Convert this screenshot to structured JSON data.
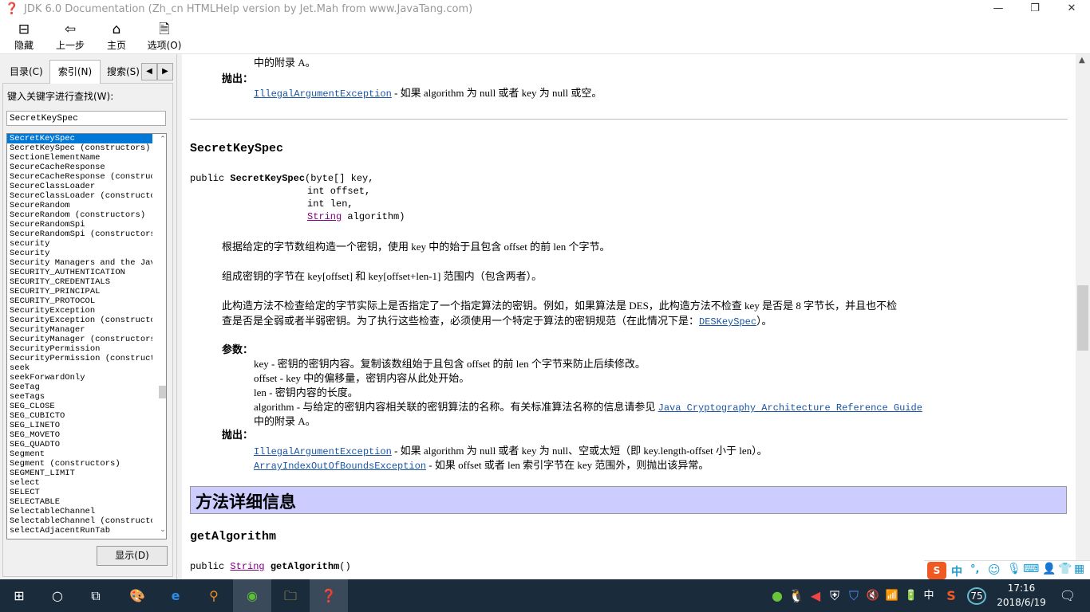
{
  "window": {
    "title": "JDK 6.0 Documentation (Zh_cn HTMLHelp version by Jet.Mah from www.JavaTang.com)"
  },
  "toolbar": {
    "hide": "隐藏",
    "back": "上一步",
    "home": "主页",
    "options": "选项(O)"
  },
  "tabs": {
    "contents": "目录(C)",
    "index": "索引(N)",
    "search": "搜索(S)"
  },
  "index": {
    "label": "键入关键字进行查找(W):",
    "value": "SecretKeySpec",
    "items": [
      "SecretKeySpec",
      "SecretKeySpec (constructors)",
      "SectionElementName",
      "SecureCacheResponse",
      "SecureCacheResponse (constructors)",
      "SecureClassLoader",
      "SecureClassLoader (constructors)",
      "SecureRandom",
      "SecureRandom (constructors)",
      "SecureRandomSpi",
      "SecureRandomSpi (constructors)",
      "security",
      "Security",
      "Security Managers and the Java",
      "SECURITY_AUTHENTICATION",
      "SECURITY_CREDENTIALS",
      "SECURITY_PRINCIPAL",
      "SECURITY_PROTOCOL",
      "SecurityException",
      "SecurityException (constructors)",
      "SecurityManager",
      "SecurityManager (constructors)",
      "SecurityPermission",
      "SecurityPermission (constructors)",
      "seek",
      "seekForwardOnly",
      "SeeTag",
      "seeTags",
      "SEG_CLOSE",
      "SEG_CUBICTO",
      "SEG_LINETO",
      "SEG_MOVETO",
      "SEG_QUADTO",
      "Segment",
      "Segment (constructors)",
      "SEGMENT_LIMIT",
      "select",
      "SELECT",
      "SELECTABLE",
      "SelectableChannel",
      "SelectableChannel (constructors)",
      "selectAdjacentRunTab"
    ],
    "show_button": "显示(D)"
  },
  "doc": {
    "prev_tail": "中的附录 A。",
    "throws": "抛出：",
    "prev_exc": "IllegalArgumentException",
    "prev_exc_desc": " - 如果 algorithm 为 null 或者 key 为 null 或空。",
    "ctor_title": "SecretKeySpec",
    "sig_pre": "public ",
    "sig_name": "SecretKeySpec",
    "sig_l1": "(byte[] key,",
    "sig_l2": "int offset,",
    "sig_l3": "int len,",
    "sig_type": "String",
    "sig_l4": " algorithm)",
    "p1": "根据给定的字节数组构造一个密钥，使用 key 中的始于且包含 offset 的前 len 个字节。",
    "p2": "组成密钥的字节在 key[offset] 和 key[offset+len-1] 范围内（包含两者）。",
    "p3a": "此构造方法不检查给定的字节实际上是否指定了一个指定算法的密钥。例如，如果算法是 DES，此构造方法不检查 key 是否是 8 字节长，并且也不检",
    "p3b": "查是否是全弱或者半弱密钥。为了执行这些检查，必须使用一个特定于算法的密钥规范（在此情况下是：",
    "p3link": "DESKeySpec",
    "p3c": "）。",
    "params": "参数：",
    "param1": "key - 密钥的密钥内容。复制该数组始于且包含 offset 的前 len 个字节来防止后续修改。",
    "param2": "offset - key 中的偏移量，密钥内容从此处开始。",
    "param3": "len - 密钥内容的长度。",
    "param4": "algorithm - 与给定的密钥内容相关联的密钥算法的名称。有关标准算法名称的信息请参见 ",
    "param4link": "Java Cryptography Architecture Reference Guide",
    "param4tail": "中的附录 A。",
    "exc1": "IllegalArgumentException",
    "exc1desc": " - 如果 algorithm 为 null 或者 key 为 null、空或太短（即 key.length-offset 小于 len）。",
    "exc2": "ArrayIndexOutOfBoundsException",
    "exc2desc": " - 如果 offset 或者 len 索引字节在 key 范围外，则抛出该异常。",
    "method_header": "方法详细信息",
    "method_title": "getAlgorithm",
    "m_pre": "public ",
    "m_type": "String",
    "m_name": " getAlgorithm",
    "m_args": "()"
  },
  "taskbar": {
    "time": "17:16",
    "date": "2018/6/19",
    "ime": "中",
    "badge": "75"
  },
  "ime_bar": {
    "lang": "中",
    "punct": "°,"
  },
  "colors": {
    "selection": "#0078d7",
    "link": "#1a56a6",
    "header_bg": "#ccccff",
    "taskbar": "#1a2b3c"
  }
}
